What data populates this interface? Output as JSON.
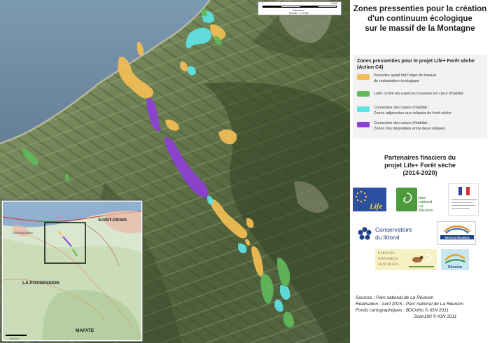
{
  "title": [
    "Zones pressenties pour la création",
    "d'un continuum écologique",
    "sur le massif de la Montagne"
  ],
  "scalebar": {
    "labels": [
      "0",
      "1,000"
    ],
    "unit": "kilomètres",
    "scale_text": "Echelle : 1:17 500"
  },
  "inset": {
    "places": [
      "SAINT-DENIS",
      "LA POSSESSION",
      "MAFATE",
      "LA POSSESSION"
    ],
    "scale_unit": "kilomètres"
  },
  "legend": {
    "title": [
      "Zones pressenties pour le projet Life+ Forêt sèche",
      "(Action C4)"
    ],
    "items": [
      {
        "lines": [
          "Parcelles ayant fait l'objet de travaux",
          "de restauration écologique"
        ],
        "color": "#f2be55"
      },
      {
        "lines": [
          "Lutte contre les espèces invasives en cœur d'habitat"
        ],
        "color": "#5fb85a"
      },
      {
        "lines": [
          "Connexion des cœurs d'habitat :",
          "Zones adjacentes aux reliques de forêt sèche"
        ],
        "color": "#5ee3e6"
      },
      {
        "lines": [
          "Connexion des cœurs d'habitat :",
          "Zones très dégradées entre deux reliques"
        ],
        "color": "#8e3fd6"
      }
    ]
  },
  "partners": {
    "title": [
      "Partenaires finaciers du",
      "projet Life+ Forêt sèche",
      "(2014-2020)"
    ],
    "logos": [
      "eu-flag-life",
      "parc-national-la-reunion",
      "prefet-region-reunion",
      "conservatoire-du-littoral",
      "region-reunion",
      "espaces-naturels-sensibles",
      "departement-la-reunion"
    ],
    "parc_name": [
      "parc national",
      "La Réunion"
    ],
    "cons_name": [
      "Conservatoire",
      "du littoral"
    ],
    "ens_name": [
      "ESPACES",
      "NATURELS",
      "SENSIBLES"
    ],
    "eu_life": "Life",
    "region_name": "RÉGION RÉUNION",
    "reunion_name": "Réunion"
  },
  "sources": [
    "Sources : Parc national de La Réunion",
    "Réalisation : Avril 2015 - Parc national de La Réunion",
    "Fonds cartographiques : BDOrtho © IGN 2011",
    "Scan100 © IGN 2011"
  ],
  "colors": {
    "restoration": "#f2be55",
    "invasive": "#5fb85a",
    "adjacent": "#5ee3e6",
    "degraded": "#8e3fd6",
    "sea": "#6f8fa8"
  }
}
